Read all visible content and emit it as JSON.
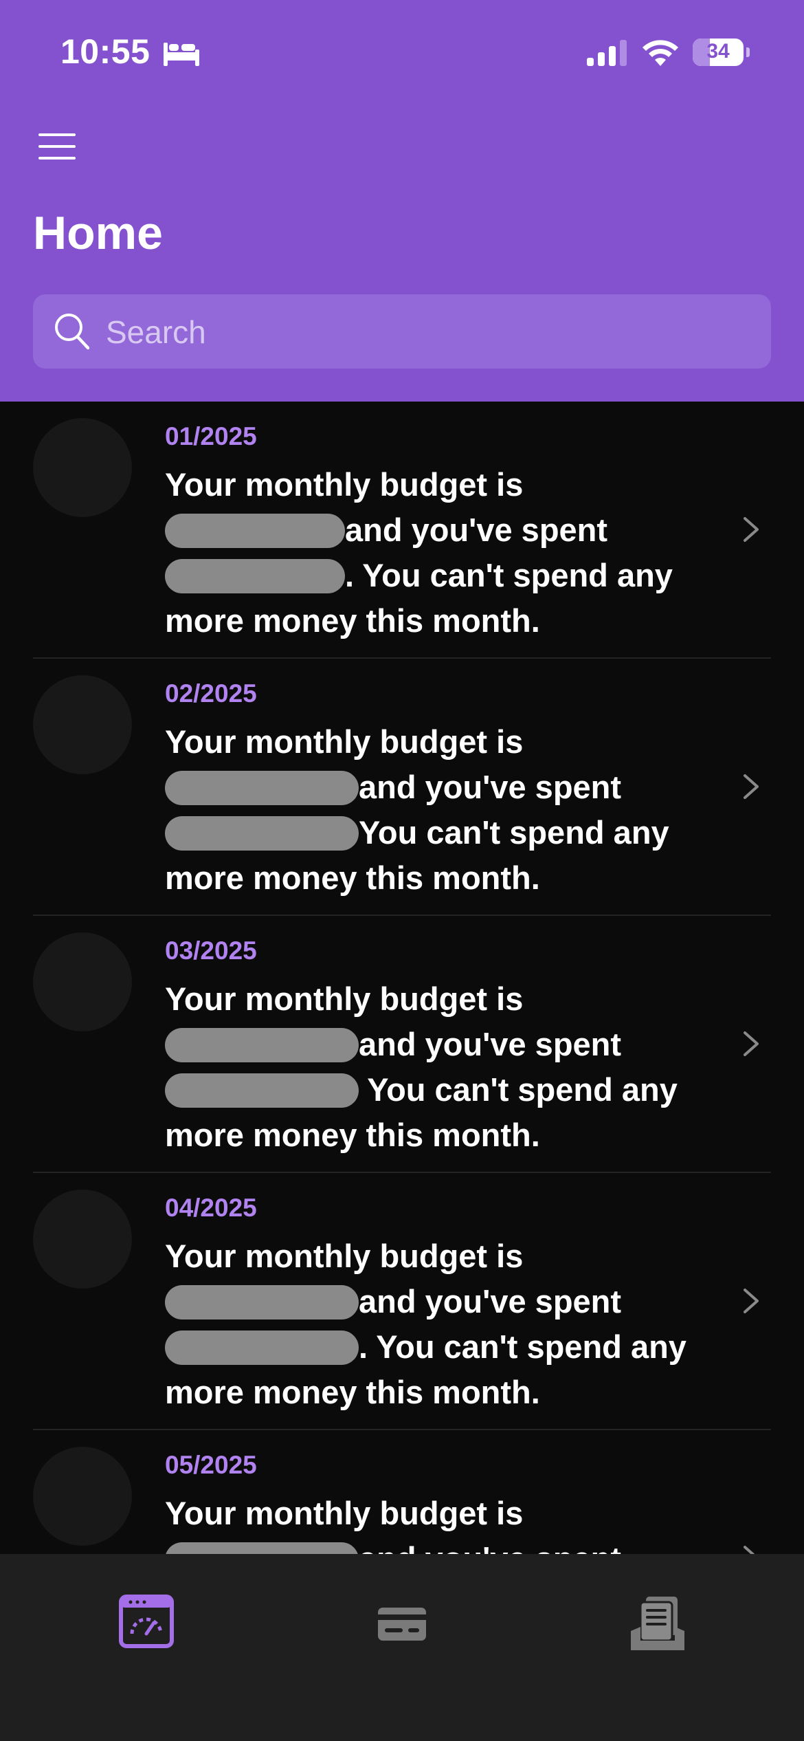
{
  "status_bar": {
    "time": "10:55",
    "focus_icon": "bed-icon",
    "battery_level": "34",
    "battery_fraction": 0.34
  },
  "header": {
    "menu_icon": "hamburger-icon",
    "title": "Home",
    "search_placeholder": "Search",
    "background_color": "#8452cf"
  },
  "rows": [
    {
      "date": "01/2025",
      "line1": "Your monthly budget is",
      "mid": "and you've spent",
      "end": ". You can't spend any more money this month."
    },
    {
      "date": "02/2025",
      "line1": "Your monthly budget is",
      "mid": "and you've spent",
      "end": "You can't spend any more money this month."
    },
    {
      "date": "03/2025",
      "line1": "Your monthly budget is",
      "mid": "and you've spent",
      "end": " You can't spend any more money this month."
    },
    {
      "date": "04/2025",
      "line1": "Your monthly budget is",
      "mid": "and you've spent",
      "end": ". You can't spend any more money this month."
    },
    {
      "date": "05/2025",
      "line1": "Your monthly budget is",
      "mid": "and you've spent",
      "end": ""
    }
  ],
  "tabs": [
    {
      "icon": "dashboard-icon",
      "active": true
    },
    {
      "icon": "credit-card-icon",
      "active": false
    },
    {
      "icon": "receipt-stack-icon",
      "active": false
    }
  ],
  "colors": {
    "accent": "#8452cf",
    "date_text": "#b183f0",
    "list_background": "#0b0b0b",
    "tabbar_background": "#1f1f1f"
  }
}
